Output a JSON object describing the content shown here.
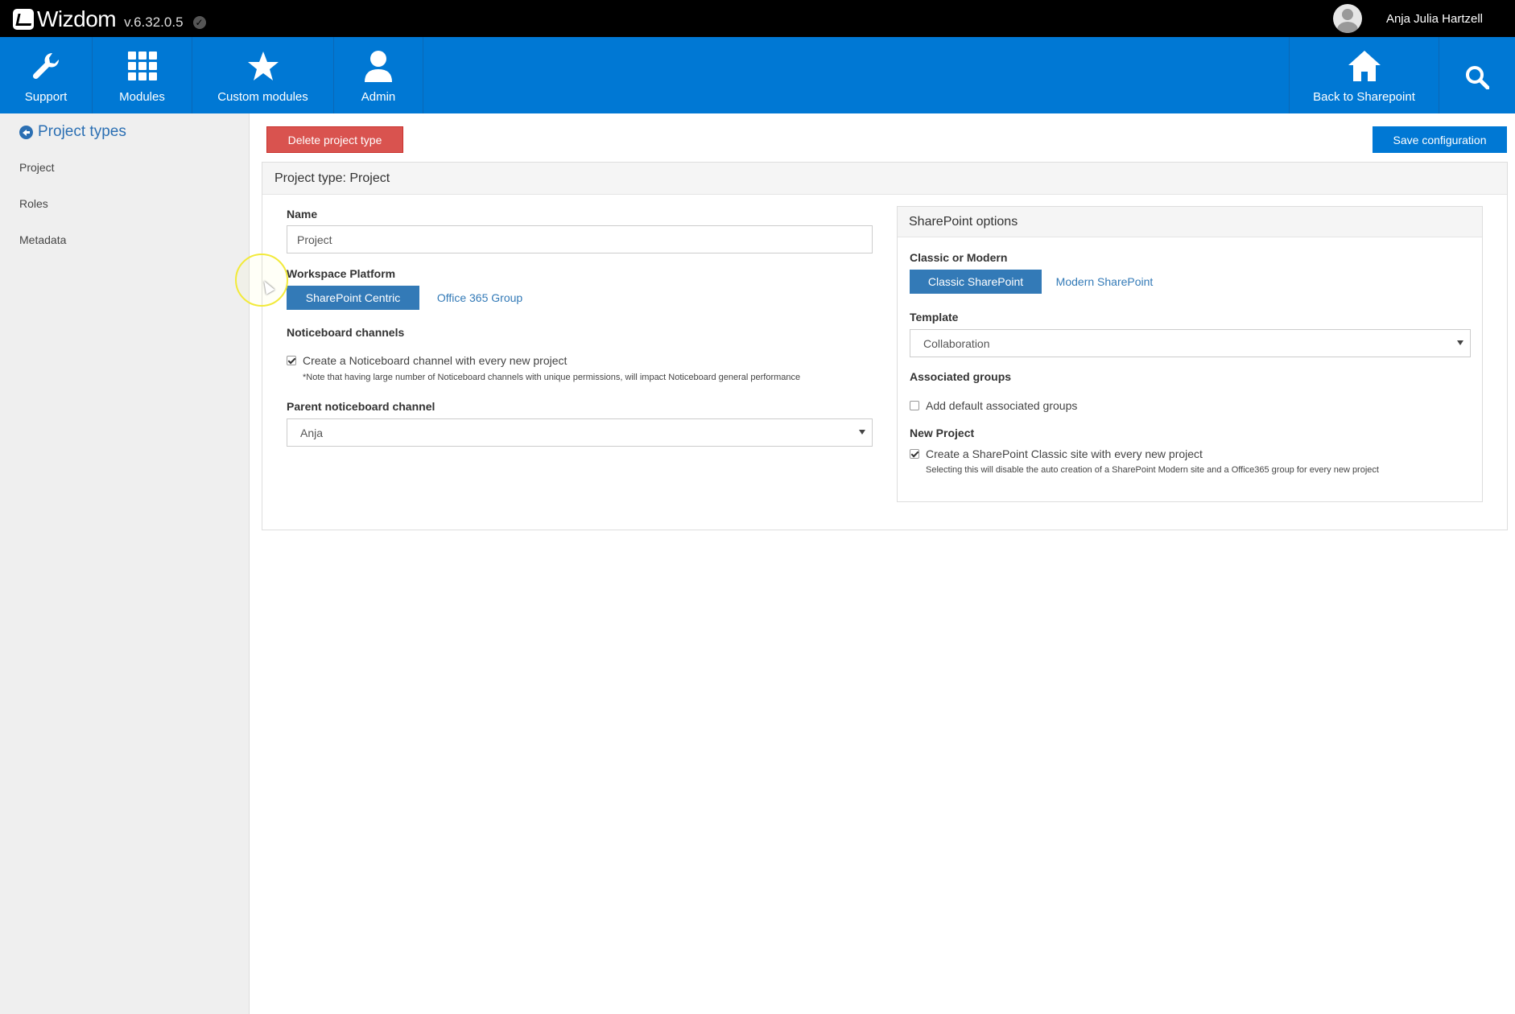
{
  "topbar": {
    "brand": "Wizdom",
    "version": "v.6.32.0.5",
    "user_name": "Anja Julia Hartzell"
  },
  "nav": {
    "left_items": [
      {
        "label": "Support",
        "icon": "wrench-icon"
      },
      {
        "label": "Modules",
        "icon": "grid-icon"
      },
      {
        "label": "Custom modules",
        "icon": "star-icon"
      },
      {
        "label": "Admin",
        "icon": "user-icon"
      }
    ],
    "right_items": [
      {
        "label": "Back to Sharepoint",
        "icon": "home-icon"
      },
      {
        "label": "",
        "icon": "search-icon"
      }
    ],
    "color": "#0078d4"
  },
  "sidebar": {
    "title": "Project types",
    "items": [
      "Project",
      "Roles",
      "Metadata"
    ]
  },
  "actions": {
    "delete_label": "Delete project type",
    "save_label": "Save configuration"
  },
  "panel": {
    "title": "Project type: Project",
    "name_label": "Name",
    "name_value": "Project",
    "workspace_label": "Workspace Platform",
    "workspace_options": [
      "SharePoint Centric",
      "Office 365 Group"
    ],
    "workspace_selected": "SharePoint Centric",
    "noticeboard_label": "Noticeboard channels",
    "noticeboard_checkbox": "Create a Noticeboard channel with every new project",
    "noticeboard_checked": true,
    "noticeboard_note": "*Note that having large number of Noticeboard channels with unique permissions, will impact Noticeboard general performance",
    "parent_label": "Parent noticeboard channel",
    "parent_value": "Anja"
  },
  "sharepoint": {
    "title": "SharePoint options",
    "classic_label": "Classic or Modern",
    "options": [
      "Classic SharePoint",
      "Modern SharePoint"
    ],
    "selected": "Classic SharePoint",
    "template_label": "Template",
    "template_value": "Collaboration",
    "groups_label": "Associated groups",
    "groups_checkbox": "Add default associated groups",
    "groups_checked": false,
    "new_project_label": "New Project",
    "new_project_checkbox": "Create a SharePoint Classic site with every new project",
    "new_project_checked": true,
    "new_project_note": "Selecting this will disable the auto creation of a SharePoint Modern site and a Office365 group for every new project"
  }
}
